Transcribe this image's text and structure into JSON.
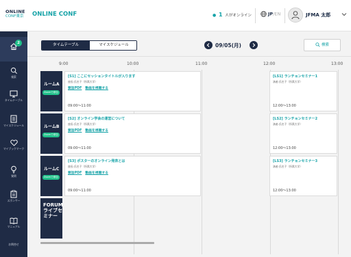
{
  "header": {
    "logo_top": "ONLINE",
    "logo_bottom": "CONF東京",
    "conference_name": "ONLINE CONF",
    "online_count": "1",
    "online_label": "人がオンライン",
    "lang_active": "JP",
    "lang_sep": "/",
    "lang_inactive": "EN",
    "user_name": "JFMA 太郎"
  },
  "sidebar": {
    "home_badge": "2",
    "items": [
      {
        "label": "検索",
        "icon": "search-icon"
      },
      {
        "label": "タイムテーブル",
        "icon": "monitor-icon"
      },
      {
        "label": "マイスケジュール",
        "icon": "document-icon"
      },
      {
        "label": "マイブックマーク",
        "icon": "heart-icon"
      },
      {
        "label": "質問",
        "icon": "bulb-icon"
      },
      {
        "label": "スポンサー",
        "icon": "clipboard-icon"
      },
      {
        "label": "マニュアル",
        "icon": "book-icon"
      },
      {
        "label": "お問合せ",
        "icon": "mail-icon"
      }
    ]
  },
  "tabs": [
    {
      "label": "タイムテーブル",
      "active": true
    },
    {
      "label": "マイスケジュール",
      "active": false
    }
  ],
  "date": "09/05(月)",
  "search_label": "検索",
  "times": [
    "9:00",
    "10:00",
    "11:00",
    "12:00",
    "13:00"
  ],
  "rooms": [
    {
      "name": "ルームA",
      "zoom": "Zoomで参加"
    },
    {
      "name": "ルームB",
      "zoom": "Zoomで参加"
    },
    {
      "name": "ルームC",
      "zoom": "Zoomで参加"
    }
  ],
  "forum": {
    "name": "FORUM\nライブセミナー"
  },
  "sessions": [
    {
      "title": "[S1] ここにセッションタイトルが入ります",
      "speaker": "座長:氏名子（所属大学）",
      "link1": "要旨PDF",
      "link2": "動画を視聴する",
      "time": "09:00～11:00"
    },
    {
      "title": "[S2] オンライン学会の運営について",
      "speaker": "座長:氏名子（所属大学）",
      "link1": "要旨PDF",
      "link2": "動画を視聴する",
      "time": "09:00～11:00"
    },
    {
      "title": "[S3] ポスターのオンライン発表とは",
      "speaker": "座長:氏名子（所属大学）",
      "link1": "要旨PDF",
      "link2": "動画を視聴する",
      "time": "09:00～11:00"
    },
    {
      "title": "[LS1] ランチョンセミナー1",
      "speaker": "演者:氏名子（所属大学）",
      "time": "12:00～13:00"
    },
    {
      "title": "[LS2] ランチョンセミナー2",
      "speaker": "演者:氏名子（所属大学）",
      "time": "12:00～13:00"
    },
    {
      "title": "[LS3] ランチョンセミナー3",
      "speaker": "演者:氏名子（所属大学）",
      "time": "12:00～13:00"
    }
  ],
  "colors": {
    "navy": "#1f2b45",
    "teal": "#16a3a8",
    "green": "#20c08a"
  }
}
